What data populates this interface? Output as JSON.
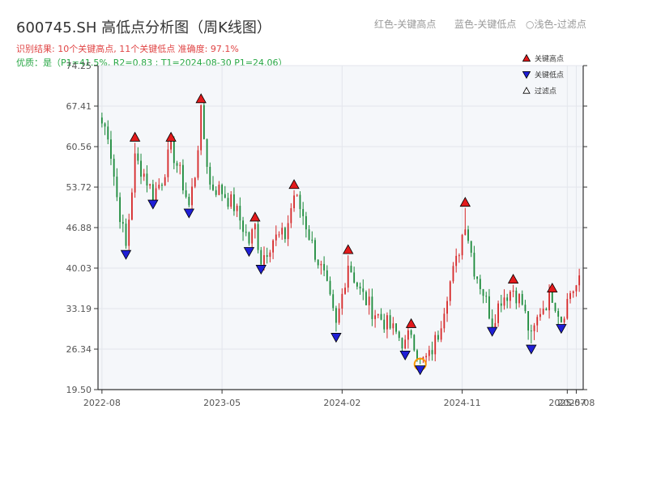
{
  "header": {
    "title": "600745.SH 高低点分析图（周K线图）",
    "subtitle_result": "识别结果: 10个关键高点, 11个关键低点  准确度: 97.1%",
    "subtitle_quality": "优质：是（P1=41.5%, R2=0.83 ; T1=2024-08-30 P1=24.06）",
    "legend_red": "红色-关键高点",
    "legend_blue": "蓝色-关键低点",
    "legend_light": "浅色-过滤点"
  },
  "colors": {
    "up_candle": "#d62728",
    "down_candle": "#1a8a3a",
    "high_marker": "#e31a1c",
    "low_marker": "#1f1fd6",
    "filtered_marker": "#ff9900",
    "plot_background": "#f5f7fa",
    "grid": "#e3e6ec"
  },
  "chart_data": {
    "type": "candlestick",
    "y_ticks": [
      "19.50",
      "26.34",
      "33.19",
      "40.03",
      "46.88",
      "53.72",
      "60.56",
      "67.41",
      "74.25"
    ],
    "ylim": [
      19.5,
      74.25
    ],
    "x_ticks": [
      {
        "label": "2022-08",
        "idx": 0
      },
      {
        "label": "2023-05",
        "idx": 40
      },
      {
        "label": "2024-02",
        "idx": 80
      },
      {
        "label": "2024-11",
        "idx": 120
      },
      {
        "label": "2025-07",
        "idx": 155
      },
      {
        "label": "2025-08",
        "idx": 158
      }
    ],
    "x_count": 160,
    "legend": [
      {
        "label": "关键高点",
        "kind": "high"
      },
      {
        "label": "关键低点",
        "kind": "low"
      },
      {
        "label": "过滤点",
        "kind": "filtered"
      }
    ],
    "key_highs": [
      {
        "idx": 11,
        "value": 62.0
      },
      {
        "idx": 23,
        "value": 62.0
      },
      {
        "idx": 33,
        "value": 68.5
      },
      {
        "idx": 51,
        "value": 48.5
      },
      {
        "idx": 64,
        "value": 54.0
      },
      {
        "idx": 82,
        "value": 43.0
      },
      {
        "idx": 103,
        "value": 30.5
      },
      {
        "idx": 121,
        "value": 51.0
      },
      {
        "idx": 137,
        "value": 38.0
      },
      {
        "idx": 150,
        "value": 36.5
      }
    ],
    "key_lows": [
      {
        "idx": 8,
        "value": 42.5
      },
      {
        "idx": 17,
        "value": 51.0
      },
      {
        "idx": 29,
        "value": 49.5
      },
      {
        "idx": 49,
        "value": 43.0
      },
      {
        "idx": 53,
        "value": 40.0
      },
      {
        "idx": 78,
        "value": 28.5
      },
      {
        "idx": 101,
        "value": 25.5
      },
      {
        "idx": 106,
        "value": 23.0
      },
      {
        "idx": 130,
        "value": 29.5
      },
      {
        "idx": 143,
        "value": 26.5
      },
      {
        "idx": 153,
        "value": 30.0
      }
    ],
    "filtered_points": [
      {
        "idx": 106,
        "value": 24.06
      }
    ],
    "price_path": [
      [
        0,
        64.5
      ],
      [
        2,
        63.0
      ],
      [
        5,
        52.0
      ],
      [
        8,
        43.5
      ],
      [
        11,
        58.5
      ],
      [
        14,
        56.0
      ],
      [
        17,
        52.5
      ],
      [
        20,
        55.0
      ],
      [
        23,
        60.5
      ],
      [
        26,
        56.0
      ],
      [
        29,
        50.5
      ],
      [
        31,
        56.0
      ],
      [
        33,
        66.0
      ],
      [
        36,
        54.0
      ],
      [
        40,
        53.0
      ],
      [
        44,
        50.5
      ],
      [
        47,
        47.0
      ],
      [
        49,
        44.5
      ],
      [
        51,
        47.0
      ],
      [
        53,
        41.5
      ],
      [
        57,
        45.0
      ],
      [
        61,
        45.5
      ],
      [
        64,
        52.5
      ],
      [
        67,
        49.0
      ],
      [
        70,
        44.0
      ],
      [
        74,
        38.5
      ],
      [
        78,
        30.0
      ],
      [
        82,
        41.0
      ],
      [
        86,
        36.0
      ],
      [
        90,
        33.0
      ],
      [
        94,
        31.0
      ],
      [
        98,
        29.0
      ],
      [
        101,
        27.0
      ],
      [
        103,
        29.5
      ],
      [
        106,
        24.0
      ],
      [
        109,
        25.0
      ],
      [
        112,
        29.0
      ],
      [
        115,
        36.0
      ],
      [
        118,
        41.0
      ],
      [
        121,
        48.0
      ],
      [
        124,
        40.0
      ],
      [
        127,
        36.0
      ],
      [
        130,
        31.0
      ],
      [
        133,
        35.0
      ],
      [
        137,
        36.5
      ],
      [
        140,
        34.0
      ],
      [
        143,
        28.0
      ],
      [
        146,
        33.0
      ],
      [
        150,
        35.5
      ],
      [
        153,
        31.5
      ],
      [
        156,
        36.0
      ],
      [
        159,
        37.5
      ]
    ]
  }
}
